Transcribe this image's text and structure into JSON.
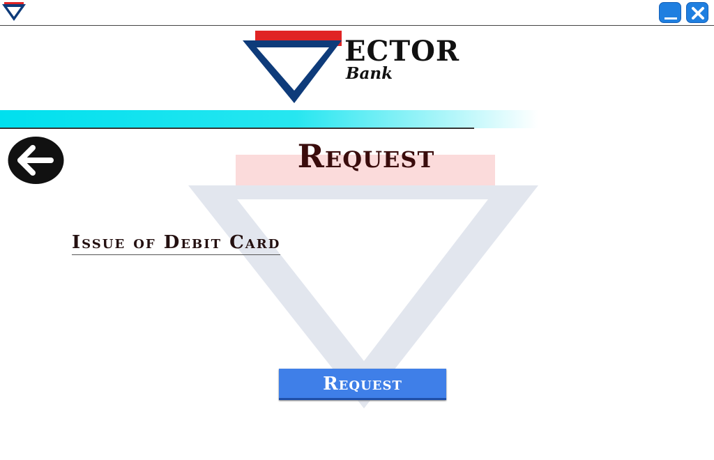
{
  "brand": {
    "name": "ECTOR",
    "sub": "Bank",
    "colors": {
      "red": "#e02424",
      "navy": "#0e3b7a"
    }
  },
  "window": {
    "icons": {
      "app": "vector-logo-icon",
      "minimize": "minimize-icon",
      "close": "close-icon"
    },
    "accent": "#1f7fe0"
  },
  "header": {
    "band_color": "#00e0ee",
    "back_icon": "arrow-left-icon",
    "title": "Request"
  },
  "main": {
    "subtitle": "Issue of Debit Card",
    "request_button": "Request",
    "button_color": "#3f7fe8"
  }
}
